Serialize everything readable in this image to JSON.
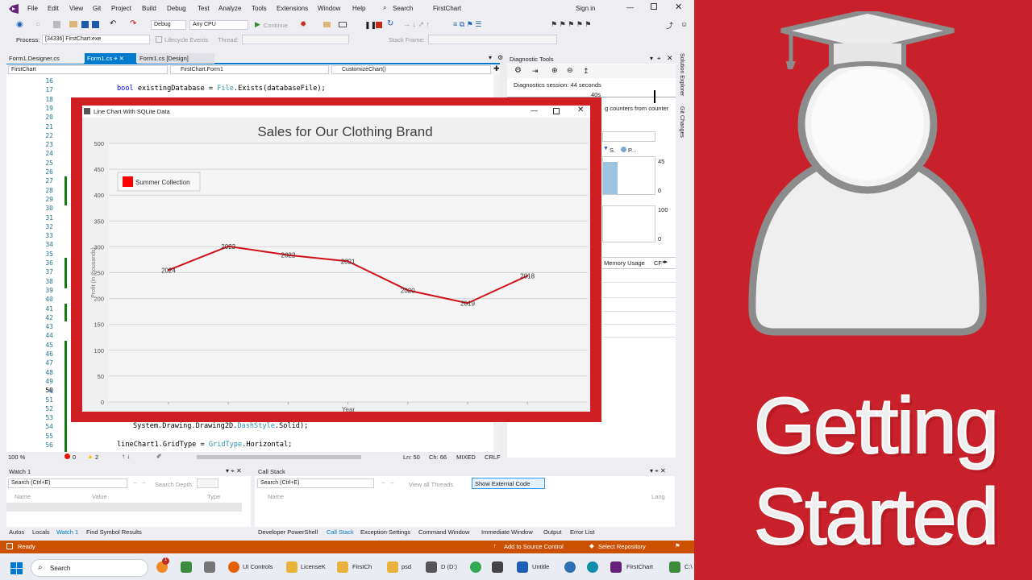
{
  "ide": {
    "menu": [
      "File",
      "Edit",
      "View",
      "Git",
      "Project",
      "Build",
      "Debug",
      "Test",
      "Analyze",
      "Tools",
      "Extensions",
      "Window",
      "Help"
    ],
    "search_label": "Search",
    "solution_name": "FirstChart",
    "sign_in": "Sign in",
    "toolbar": {
      "config": "Debug",
      "platform": "Any CPU",
      "continue": "Continue",
      "process_label": "Process:",
      "process_value": "[34336] FirstChart.exe",
      "lifecycle": "Lifecycle Events",
      "thread_label": "Thread:",
      "stack_frame_label": "Stack Frame:"
    },
    "doc_tabs": [
      "Form1.Designer.cs",
      "Form1.cs",
      "Form1.cs [Design]"
    ],
    "nav": {
      "project": "FirstChart",
      "class": "FirstChart.Form1",
      "member": "CustomizeChart()"
    },
    "line_numbers": [
      "16",
      "17",
      "18",
      "19",
      "20",
      "21",
      "22",
      "23",
      "24",
      "25",
      "26",
      "27",
      "28",
      "29",
      "30",
      "31",
      "32",
      "33",
      "34",
      "35",
      "36",
      "37",
      "38",
      "39",
      "40",
      "41",
      "42",
      "43",
      "44",
      "45",
      "46",
      "47",
      "48",
      "49",
      "50",
      "51",
      "52",
      "53",
      "54",
      "55",
      "56"
    ],
    "code": {
      "line17_kw": "bool",
      "line17_rest": " existingDatabase = ",
      "line17_type": "File",
      "line17_end": ".Exists(databaseFile);",
      "line54_start": "System.Drawing.Drawing2D.",
      "line54_type": "DashStyle",
      "line54_end": ".Solid);",
      "line56_start": "lineChart1.GridType = ",
      "line56_type": "GridType",
      "line56_end": ".Horizontal;"
    },
    "editor_status": {
      "zoom": "100 %",
      "errors": "0",
      "warnings": "2",
      "ln": "Ln: 50",
      "ch": "Ch: 66",
      "mixed": "MIXED",
      "crlf": "CRLF"
    },
    "diagnostic": {
      "title": "Diagnostic Tools",
      "session": "Diagnostics session: 44 seconds",
      "time_mark": "40s",
      "counters_text": "g counters from counter",
      "legend_s": "S.",
      "legend_p": "P...",
      "scale_45": "45",
      "scale_0a": "0",
      "scale_100": "100",
      "scale_0b": "0",
      "memory_tab": "Memory Usage",
      "cpu_tab": "CF"
    },
    "side_tabs": [
      "Solution Explorer",
      "Git Changes"
    ],
    "watch": {
      "title": "Watch 1",
      "search_placeholder": "Search (Ctrl+E)",
      "depth_label": "Search Depth:",
      "col_name": "Name",
      "col_value": "Value",
      "col_type": "Type"
    },
    "callstack": {
      "title": "Call Stack",
      "search_placeholder": "Search (Ctrl+E)",
      "view_all": "View all Threads",
      "show_external": "Show External Code",
      "col_name": "Name",
      "col_lang": "Lang"
    },
    "bottom_tabs_left": [
      "Autos",
      "Locals",
      "Watch 1",
      "Find Symbol Results"
    ],
    "bottom_tabs_right": [
      "Developer PowerShell",
      "Call Stack",
      "Exception Settings",
      "Command Window",
      "Immediate Window",
      "Output",
      "Error List"
    ],
    "status": {
      "ready": "Ready",
      "source_control": "Add to Source Control",
      "repo": "Select Repository"
    }
  },
  "taskbar": {
    "search": "Search",
    "items": [
      "UI Controls",
      "LicenseK",
      "FirstCh",
      "psd",
      "D (D:)",
      "Untitle",
      "FirstChart",
      "C:\\"
    ],
    "badge": "1"
  },
  "chart_window": {
    "title": "Line Chart With SQLite Data"
  },
  "chart_data": {
    "type": "line",
    "title": "Sales for Our Clothing Brand",
    "xlabel": "Year",
    "ylabel": "Profit (in thousands)",
    "ylim": [
      0,
      500
    ],
    "yticks": [
      0,
      50,
      100,
      150,
      200,
      250,
      300,
      350,
      400,
      450,
      500
    ],
    "legend": "top-left",
    "series": [
      {
        "name": "Summer Collection",
        "color": "#ff0000",
        "points": [
          {
            "label": "2024",
            "value": 255
          },
          {
            "label": "2023",
            "value": 301
          },
          {
            "label": "2022",
            "value": 284
          },
          {
            "label": "2021",
            "value": 272
          },
          {
            "label": "2020",
            "value": 216
          },
          {
            "label": "2019",
            "value": 191
          },
          {
            "label": "2018",
            "value": 244
          }
        ]
      }
    ],
    "grid": true
  },
  "banner": {
    "line1": "Getting",
    "line2": "Started"
  },
  "colors": {
    "accent_red": "#c8212b",
    "status_orange": "#ca5100",
    "vs_purple": "#68217a"
  }
}
